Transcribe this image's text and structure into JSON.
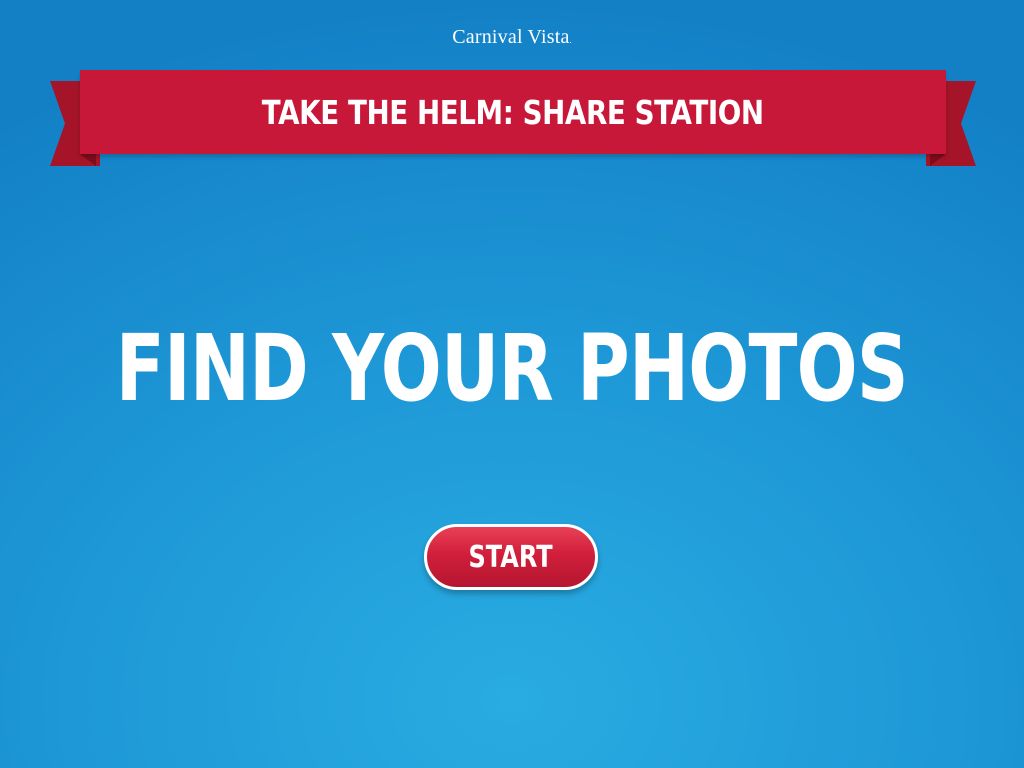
{
  "brand": {
    "name": "Carnival Vista",
    "trademark": "."
  },
  "banner": {
    "title": "TAKE THE HELM: SHARE STATION",
    "color": "#c8183a"
  },
  "headline": {
    "text": "FIND YOUR PHOTOS"
  },
  "start_button": {
    "label": "START",
    "color": "#d11f3c"
  },
  "theme": {
    "background": "#1f9ad8",
    "text": "#ffffff"
  }
}
